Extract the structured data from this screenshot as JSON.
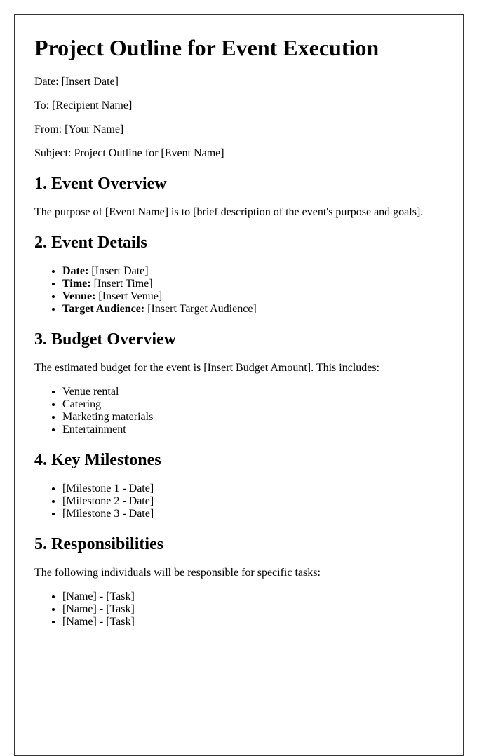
{
  "document": {
    "title": "Project Outline for Event Execution",
    "meta": {
      "date": "Date: [Insert Date]",
      "to": "To: [Recipient Name]",
      "from": "From: [Your Name]",
      "subject": "Subject: Project Outline for [Event Name]"
    },
    "sections": {
      "overview": {
        "heading": "1. Event Overview",
        "text": "The purpose of [Event Name] is to [brief description of the event's purpose and goals]."
      },
      "details": {
        "heading": "2. Event Details",
        "items": [
          {
            "label": "Date:",
            "value": " [Insert Date]"
          },
          {
            "label": "Time:",
            "value": " [Insert Time]"
          },
          {
            "label": "Venue:",
            "value": " [Insert Venue]"
          },
          {
            "label": "Target Audience:",
            "value": " [Insert Target Audience]"
          }
        ]
      },
      "budget": {
        "heading": "3. Budget Overview",
        "text": "The estimated budget for the event is [Insert Budget Amount]. This includes:",
        "items": [
          "Venue rental",
          "Catering",
          "Marketing materials",
          "Entertainment"
        ]
      },
      "milestones": {
        "heading": "4. Key Milestones",
        "items": [
          "[Milestone 1 - Date]",
          "[Milestone 2 - Date]",
          "[Milestone 3 - Date]"
        ]
      },
      "responsibilities": {
        "heading": "5. Responsibilities",
        "text": "The following individuals will be responsible for specific tasks:",
        "items": [
          "[Name] - [Task]",
          "[Name] - [Task]",
          "[Name] - [Task]"
        ]
      }
    }
  }
}
